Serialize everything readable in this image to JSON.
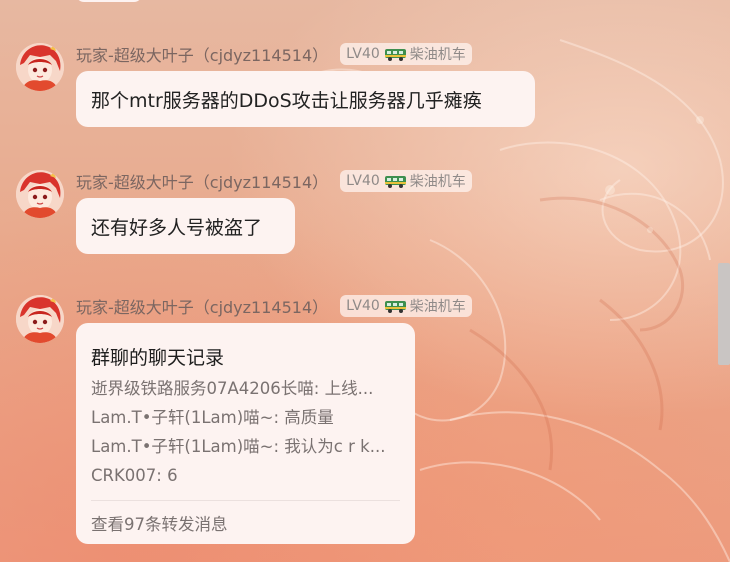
{
  "colors": {
    "bubble_bg": "#fdf3f1",
    "sender_text": "#7b6661",
    "level_text": "#8f8a88",
    "secondary_text": "#7a7271"
  },
  "messages": [
    {
      "sender": "玩家-超级大叶子（cjdyz114514）",
      "level": "LV40",
      "title_badge": "柴油机车",
      "text": "那个mtr服务器的DDoS攻击让服务器几乎瘫痪"
    },
    {
      "sender": "玩家-超级大叶子（cjdyz114514）",
      "level": "LV40",
      "title_badge": "柴油机车",
      "text": "还有好多人号被盗了"
    },
    {
      "sender": "玩家-超级大叶子（cjdyz114514）",
      "level": "LV40",
      "title_badge": "柴油机车",
      "forward_card": {
        "title": "群聊的聊天记录",
        "lines": [
          "逝界级铁路服务07A4206长喵: 上线...",
          "Lam.T•子轩(1Lam)喵~: 高质量",
          "Lam.T•子轩(1Lam)喵~: 我认为c r k...",
          "CRK007: 6"
        ],
        "footer": "查看97条转发消息"
      }
    }
  ],
  "icons": {
    "avatar": "anime-avatar-icon",
    "badge": "train-icon"
  }
}
